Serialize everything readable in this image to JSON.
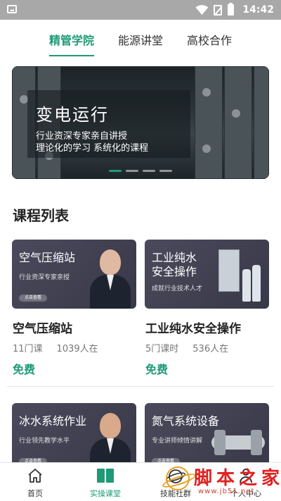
{
  "status_bar": {
    "time": "14:42",
    "icons": [
      "gallery-icon",
      "wifi-icon",
      "sim-icon",
      "battery-icon"
    ]
  },
  "tabs": [
    {
      "label": "精管学院",
      "active": true
    },
    {
      "label": "能源讲堂",
      "active": false
    },
    {
      "label": "高校合作",
      "active": false
    }
  ],
  "banner": {
    "title": "变电运行",
    "line1": "行业资深专家亲自讲授",
    "line2": "理论化的学习  系统化的课程",
    "slides": 4,
    "active_slide": 1
  },
  "section": {
    "title": "课程列表"
  },
  "courses": [
    {
      "thumb_title": "空气压缩站",
      "thumb_desc": "行业资深专家亲授",
      "thumb_button": "点击查看",
      "title": "空气压缩站",
      "lessons": "11门课",
      "learners": "1039人在",
      "price": "免费"
    },
    {
      "thumb_title_line1": "工业纯水",
      "thumb_title_line2": "安全操作",
      "thumb_desc": "成就行业技术人才",
      "thumb_button": "点击查看",
      "title": "工业纯水安全操作",
      "lessons": "5门课时",
      "learners": "536人在",
      "price": "免费"
    },
    {
      "thumb_title": "冰水系统作业",
      "thumb_desc": "行业领先教学水平",
      "thumb_button": "点击查看"
    },
    {
      "thumb_title": "氮气系统设备",
      "thumb_desc": "专业讲师倾情讲解",
      "thumb_button": "点击查看"
    }
  ],
  "bottom_nav": [
    {
      "label": "首页",
      "icon": "home-icon",
      "active": false
    },
    {
      "label": "实操课堂",
      "icon": "book-icon",
      "active": true
    },
    {
      "label": "技能社群",
      "icon": "planet-icon",
      "active": false
    },
    {
      "label": "个人中心",
      "icon": "user-icon",
      "active": false
    }
  ],
  "watermark": {
    "text": "脚本之家",
    "url": "www.jb51.net"
  },
  "colors": {
    "accent": "#1f9a78",
    "status_bar": "#a8a8a8",
    "card_bg": "#44444f",
    "watermark_red": "#e21f1f"
  }
}
